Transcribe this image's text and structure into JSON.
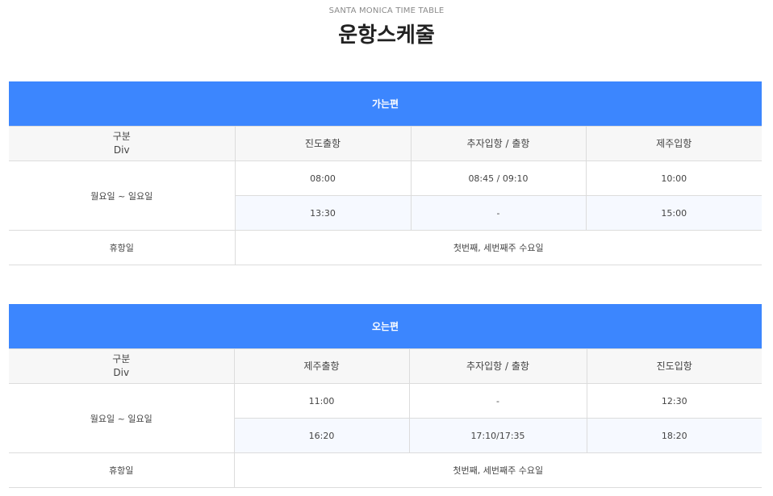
{
  "header": {
    "subtitle": "SANTA MONICA TIME TABLE",
    "title": "운항스케줄"
  },
  "outbound": {
    "banner": "가는편",
    "div_label_ko": "구분",
    "div_label_en": "Div",
    "columns": [
      "진도출항",
      "추자입항 / 출항",
      "제주입항"
    ],
    "day_label": "월요일 ~ 일요일",
    "rows": [
      [
        "08:00",
        "08:45 / 09:10",
        "10:00"
      ],
      [
        "13:30",
        "-",
        "15:00"
      ]
    ],
    "holiday_label": "휴항일",
    "holiday_value": "첫번째, 세번째주 수요일"
  },
  "return": {
    "banner": "오는편",
    "div_label_ko": "구분",
    "div_label_en": "Div",
    "columns": [
      "제주출항",
      "추자입항 / 출항",
      "진도입항"
    ],
    "day_label": "월요일 ~ 일요일",
    "rows": [
      [
        "11:00",
        "-",
        "12:30"
      ],
      [
        "16:20",
        "17:10/17:35",
        "18:20"
      ]
    ],
    "holiday_label": "휴항일",
    "holiday_value": "첫번째, 세번째주 수요일"
  }
}
